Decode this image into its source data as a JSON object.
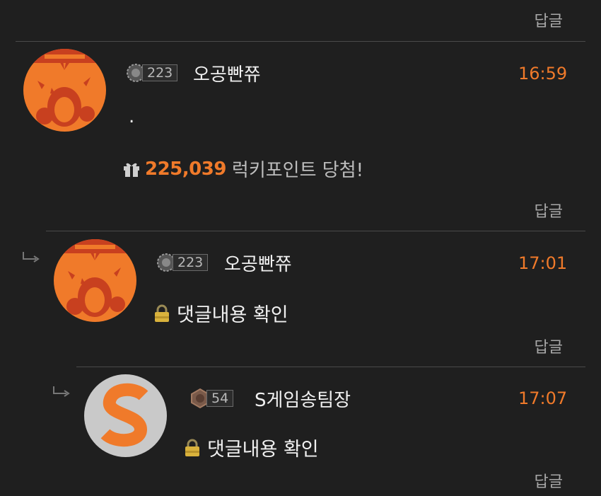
{
  "reply_label": "답글",
  "comments": [
    {
      "level": "223",
      "nickname": "오공빤쮸",
      "time": "16:59",
      "body": ".",
      "lucky_points": "225,039",
      "lucky_text": "럭키포인트 당첨!"
    },
    {
      "level": "223",
      "nickname": "오공빤쮸",
      "time": "17:01",
      "body": "댓글내용 확인"
    },
    {
      "level": "54",
      "nickname": "S게임송팀장",
      "time": "17:07",
      "body": "댓글내용 확인"
    }
  ],
  "colors": {
    "accent": "#f07a2a",
    "background": "#1f1f1f",
    "avatar_red": "#c8401f",
    "avatar_orange": "#f07a2a"
  },
  "icons": [
    "reply-arrow-icon",
    "gift-icon",
    "lock-icon",
    "level-emblem-icon"
  ]
}
